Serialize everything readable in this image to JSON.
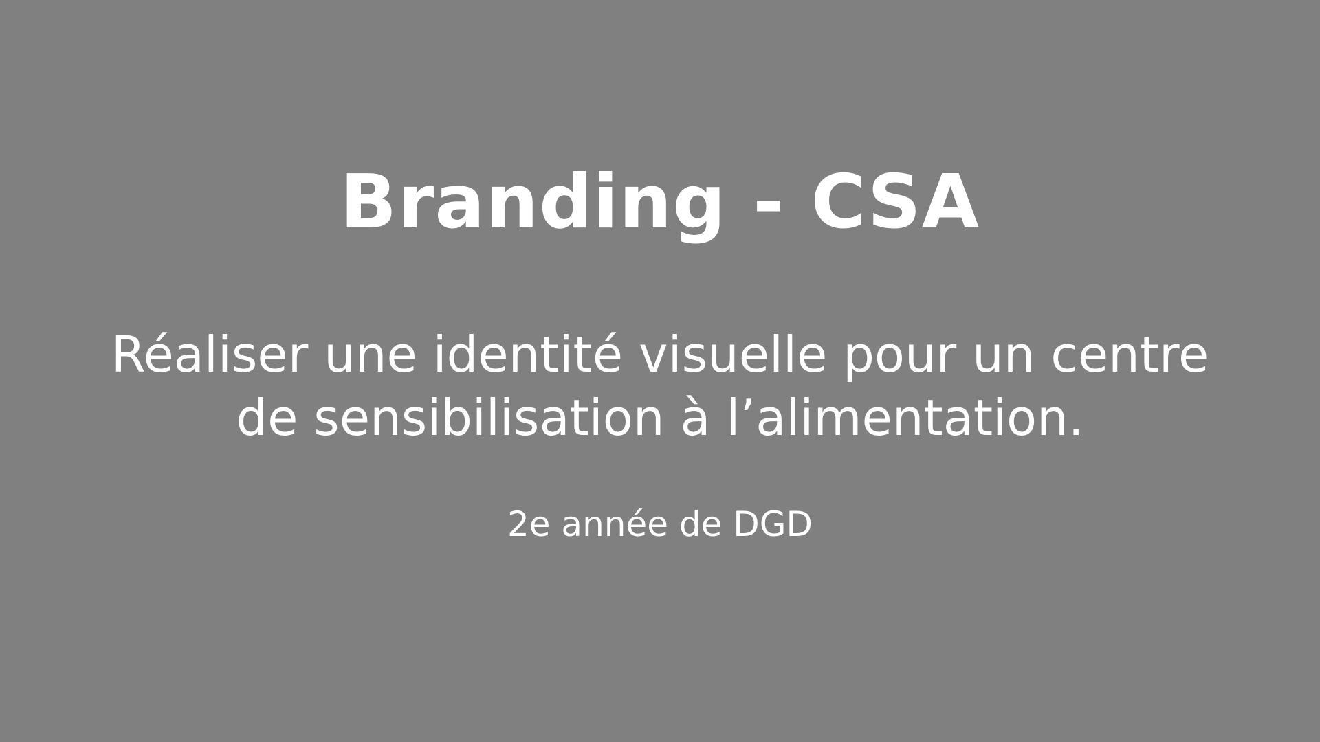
{
  "slide": {
    "title": "Branding - CSA",
    "description_lines": [
      "Réaliser une identité visuelle pour un centre",
      "de sensibilisation à l’alimentation."
    ],
    "subtitle": "2e année de DGD"
  },
  "colors": {
    "background": "#808080",
    "text": "#ffffff"
  }
}
